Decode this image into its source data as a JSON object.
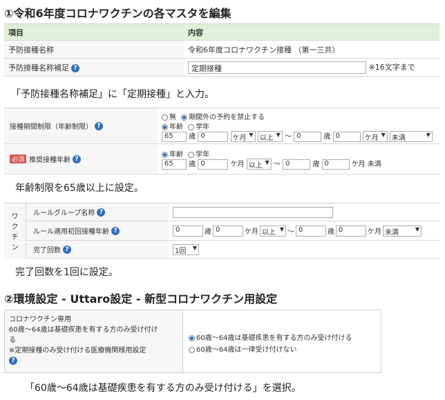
{
  "section1": {
    "heading": "①令和6年度コロナワクチンの各マスタを編集",
    "table": {
      "col_item": "項目",
      "col_content": "内容",
      "row1_label": "予防接種名称",
      "row1_value": "令和6年度コロナワクチン接種 （第一三共）",
      "row2_label": "予防接種名称補足",
      "row2_value": "定期接種",
      "row2_note": "※16文字まで"
    },
    "caption1": "「予防接種名称補足」に「定期接種」と入力。",
    "period": {
      "label": "接種期間制限（年齢制限）",
      "radio_none": "無",
      "radio_block": "期間外の予約を禁止する",
      "radio_age": "年齢",
      "radio_grade": "学年",
      "from_age": "65",
      "from_month": "0",
      "to_age": "0",
      "to_month": "0",
      "unit_age": "歳",
      "unit_month": "ケ月",
      "sel_ijo": "以上",
      "sel_miman": "未満",
      "tilde": "〜"
    },
    "recommended": {
      "badge": "必須",
      "label": "推奨接種年齢",
      "radio_age": "年齢",
      "radio_grade": "学年",
      "from_age": "65",
      "from_month": "0",
      "to_age": "0",
      "to_month": "0",
      "unit_age": "歳",
      "unit_month": "ケ月",
      "sel_ijo": "以上",
      "to_suffix": "ケ月 未満",
      "tilde": "〜"
    },
    "caption2": "年齢制限を65歳以上に設定。",
    "rule": {
      "side_tab": [
        "ワ",
        "ク",
        "チ",
        "ン"
      ],
      "group_label": "ルールグループ名称",
      "group_value": "",
      "age_label": "ルール適用初回接種年齢",
      "from_age": "0",
      "from_month": "0",
      "to_age": "0",
      "to_month": "0",
      "unit_age": "歳",
      "unit_month": "ケ月",
      "sel_ijo": "以上",
      "sel_miman": "未満",
      "tilde": "〜",
      "count_label": "完了回数",
      "count_value": "1回"
    },
    "caption3": "完了回数を1回に設定。"
  },
  "section2": {
    "heading": "②環境設定 - Uttaro設定 - 新型コロナワクチン用設定",
    "label_line1": "コロナワクチン専用",
    "label_line2": "60歳〜64歳は基礎疾患を有する方のみ受け付け",
    "label_line3": "る",
    "label_line4": "※定期接種のみ受け付ける医療機関様用設定",
    "option1": "60歳〜64歳は基礎疾患を有する方のみ受け付ける",
    "option2": "60歳〜64歳は一律受け付けない",
    "caption": "「60歳〜64歳は基礎疾患を有する方のみ受け付ける」を選択。"
  }
}
